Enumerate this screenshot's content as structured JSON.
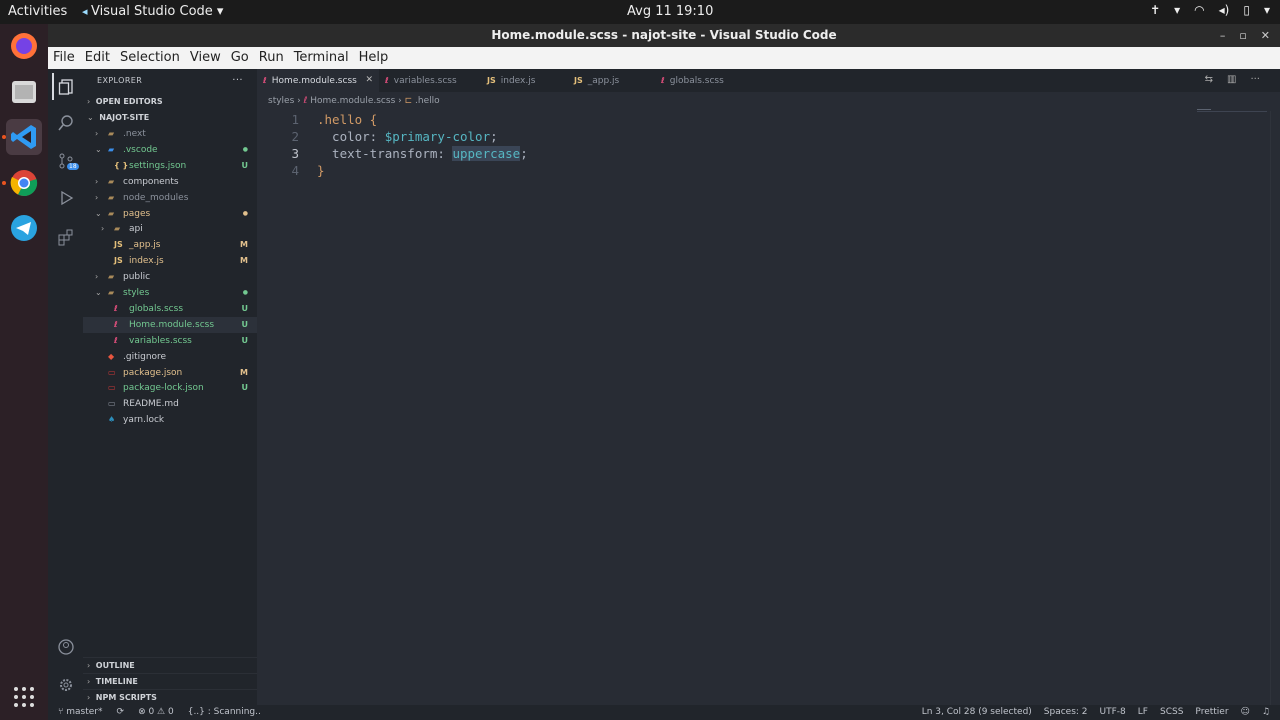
{
  "system": {
    "activities": "Activities",
    "app_menu": "Visual Studio Code",
    "clock": "Avg 11  19:10"
  },
  "window": {
    "title": "Home.module.scss - najot-site - Visual Studio Code"
  },
  "menu": [
    "File",
    "Edit",
    "Selection",
    "View",
    "Go",
    "Run",
    "Terminal",
    "Help"
  ],
  "explorer": {
    "header": "EXPLORER",
    "more": "···",
    "open_editors": "OPEN EDITORS",
    "project": "NAJOT-SITE",
    "tree": [
      {
        "name": ".next",
        "icon": "folder-icon",
        "depth": 1,
        "chevron": ">",
        "status": "",
        "color": "#8b919c"
      },
      {
        "name": ".vscode",
        "icon": "vscode-folder-icon",
        "depth": 1,
        "chevron": "v",
        "status": "●",
        "color": "#73c991"
      },
      {
        "name": "settings.json",
        "icon": "json-icon",
        "depth": 2,
        "chevron": "",
        "status": "U",
        "color": "#73c991"
      },
      {
        "name": "components",
        "icon": "folder-icon",
        "depth": 1,
        "chevron": ">",
        "status": "",
        "color": "#c9ccd2"
      },
      {
        "name": "node_modules",
        "icon": "folder-icon",
        "depth": 1,
        "chevron": ">",
        "status": "",
        "color": "#8b919c"
      },
      {
        "name": "pages",
        "icon": "folder-icon",
        "depth": 1,
        "chevron": "v",
        "status": "●",
        "color": "#e2c08d"
      },
      {
        "name": "api",
        "icon": "folder-icon",
        "depth": 2,
        "chevron": ">",
        "status": "",
        "color": "#c9ccd2"
      },
      {
        "name": "_app.js",
        "icon": "js-icon",
        "depth": 2,
        "chevron": "",
        "status": "M",
        "color": "#e2c08d"
      },
      {
        "name": "index.js",
        "icon": "js-icon",
        "depth": 2,
        "chevron": "",
        "status": "M",
        "color": "#e2c08d"
      },
      {
        "name": "public",
        "icon": "folder-icon",
        "depth": 1,
        "chevron": ">",
        "status": "",
        "color": "#c9ccd2"
      },
      {
        "name": "styles",
        "icon": "folder-icon",
        "depth": 1,
        "chevron": "v",
        "status": "●",
        "color": "#73c991"
      },
      {
        "name": "globals.scss",
        "icon": "scss-icon",
        "depth": 2,
        "chevron": "",
        "status": "U",
        "color": "#73c991"
      },
      {
        "name": "Home.module.scss",
        "icon": "scss-icon",
        "depth": 2,
        "chevron": "",
        "status": "U",
        "color": "#73c991",
        "selected": true
      },
      {
        "name": "variables.scss",
        "icon": "scss-icon",
        "depth": 2,
        "chevron": "",
        "status": "U",
        "color": "#73c991"
      },
      {
        "name": ".gitignore",
        "icon": "git-icon",
        "depth": 1,
        "chevron": "",
        "status": "",
        "color": "#c9ccd2"
      },
      {
        "name": "package.json",
        "icon": "npm-icon",
        "depth": 1,
        "chevron": "",
        "status": "M",
        "color": "#e2c08d"
      },
      {
        "name": "package-lock.json",
        "icon": "npm-icon",
        "depth": 1,
        "chevron": "",
        "status": "U",
        "color": "#73c991"
      },
      {
        "name": "README.md",
        "icon": "markdown-icon",
        "depth": 1,
        "chevron": "",
        "status": "",
        "color": "#c9ccd2"
      },
      {
        "name": "yarn.lock",
        "icon": "yarn-icon",
        "depth": 1,
        "chevron": "",
        "status": "",
        "color": "#c9ccd2"
      }
    ],
    "outline": "OUTLINE",
    "timeline": "TIMELINE",
    "npm_scripts": "NPM SCRIPTS"
  },
  "tabs": [
    {
      "label": "Home.module.scss",
      "icon": "scss-icon",
      "active": true
    },
    {
      "label": "variables.scss",
      "icon": "scss-icon",
      "active": false
    },
    {
      "label": "index.js",
      "icon": "js-icon",
      "active": false
    },
    {
      "label": "_app.js",
      "icon": "js-icon",
      "active": false
    },
    {
      "label": "globals.scss",
      "icon": "scss-icon",
      "active": false
    }
  ],
  "breadcrumbs": {
    "a": "styles",
    "b": "Home.module.scss",
    "c": ".hello"
  },
  "code": {
    "l1": {
      "num": "1",
      "sel": ".hello",
      "brace": " {"
    },
    "l2": {
      "num": "2",
      "prop": "  color: ",
      "val": "$primary-color",
      "end": ";"
    },
    "l3": {
      "num": "3",
      "prop": "  text-transform: ",
      "val": "uppercase",
      "end": ";"
    },
    "l4": {
      "num": "4",
      "brace": "}"
    }
  },
  "status": {
    "branch": "master*",
    "problems": "⊗ 0 ⚠ 0",
    "scanning": "{..} : Scanning..",
    "position": "Ln 3, Col 28 (9 selected)",
    "spaces": "Spaces: 2",
    "encoding": "UTF-8",
    "eol": "LF",
    "language": "SCSS",
    "formatter": "Prettier"
  }
}
